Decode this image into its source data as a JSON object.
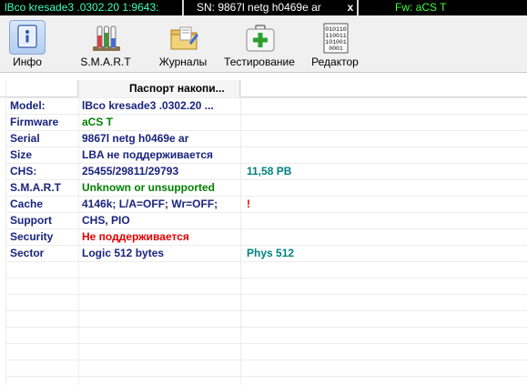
{
  "status_bar": {
    "model_text": "lBco kresade3 .0302.20 1:9643:",
    "sn_text": "SN: 9867l netg h0469e ar",
    "close_label": "x",
    "fw_text": "Fw: aCS T",
    "colors": {
      "model": "#40ffc0",
      "sn": "#ffffff",
      "fw": "#40ff40",
      "close": "#ffffff"
    }
  },
  "toolbar": {
    "buttons": [
      {
        "label": "Инфо",
        "icon": "info-icon",
        "active": true
      },
      {
        "label": "S.M.A.R.T",
        "icon": "test-tubes-icon"
      },
      {
        "label": "Журналы",
        "icon": "folder-pen-icon"
      },
      {
        "label": "Тестирование",
        "icon": "first-aid-kit-icon"
      },
      {
        "label": "Редактор",
        "icon": "binary-document-icon"
      }
    ]
  },
  "passport": {
    "header": "Паспорт накопи...",
    "rows": [
      {
        "key": "Model:",
        "value": "lBco kresade3 .0302.20 ...",
        "value_color": "#1a237e",
        "extra": "",
        "extra_color": "#008080"
      },
      {
        "key": "Firmware",
        "value": "aCS T",
        "value_color": "#008000",
        "extra": "",
        "extra_color": "#008080"
      },
      {
        "key": "Serial",
        "value": "9867l netg h0469e ar",
        "value_color": "#1a237e",
        "extra": "",
        "extra_color": "#008080"
      },
      {
        "key": "Size",
        "value": "LBA не поддерживается",
        "value_color": "#1a237e",
        "extra": "",
        "extra_color": "#008080"
      },
      {
        "key": "CHS:",
        "value": "25455/29811/29793",
        "value_color": "#1a237e",
        "extra": "11,58 PB",
        "extra_color": "#008080"
      },
      {
        "key": "S.M.A.R.T",
        "value": "Unknown or unsupported",
        "value_color": "#008000",
        "extra": "",
        "extra_color": "#008080"
      },
      {
        "key": "Cache",
        "value": "4146k; L/A=OFF; Wr=OFF;",
        "value_color": "#1a237e",
        "extra": "!",
        "extra_color": "#e00000"
      },
      {
        "key": "Support",
        "value": "CHS, PIO",
        "value_color": "#1a237e",
        "extra": "",
        "extra_color": "#008080"
      },
      {
        "key": "Security",
        "value": "Не поддерживается",
        "value_color": "#e00000",
        "extra": "",
        "extra_color": "#008080"
      },
      {
        "key": "Sector",
        "value": "Logic 512 bytes",
        "value_color": "#1a237e",
        "extra": "Phys 512",
        "extra_color": "#008080"
      }
    ]
  }
}
